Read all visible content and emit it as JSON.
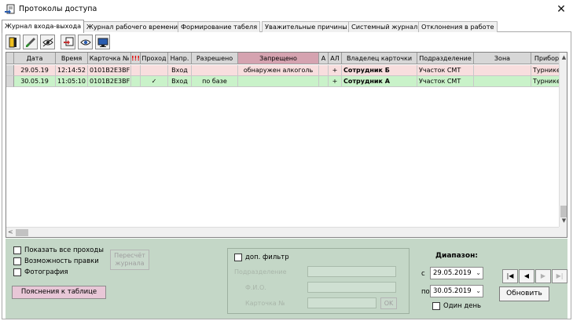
{
  "window": {
    "title": "Протоколы доступа",
    "close_glyph": "✕",
    "app_icon": "document-arrow-icon"
  },
  "tabs": [
    {
      "label": "Журнал входа-выхода",
      "active": true
    },
    {
      "label": "Журнал рабочего времени",
      "active": false
    },
    {
      "label": "Формирование табеля",
      "active": false
    },
    {
      "label": "Уважительные причины",
      "active": false
    },
    {
      "label": "Системный журнал",
      "active": false
    },
    {
      "label": "Отклонения в работе",
      "active": false
    }
  ],
  "toolbar": {
    "buttons": [
      "door-exit-icon",
      "brush-icon",
      "eye-hidden-icon",
      "export-icon",
      "eye-icon",
      "monitor-icon"
    ]
  },
  "grid": {
    "headers": [
      "Дата",
      "Время",
      "Карточка №",
      "!!!",
      "Проход",
      "Напр.",
      "Разрешено",
      "Запрещено",
      "А",
      "АЛ",
      "Владелец карточки",
      "Подразделение",
      "Зона",
      "Прибор"
    ],
    "rows": [
      {
        "status": "denied",
        "cells": [
          "29.05.19",
          "12:14:52",
          "0101B2E3BF",
          "",
          "",
          "Вход",
          "",
          "обнаружен алкоголь",
          "",
          "+",
          "Сотрудник Б",
          "Участок СМТ",
          "",
          "Турникет"
        ]
      },
      {
        "status": "allowed",
        "cells": [
          "30.05.19",
          "11:05:10",
          "0101B2E3BF",
          "",
          "✓",
          "Вход",
          "по базе",
          "",
          "",
          "+",
          "Сотрудник А",
          "Участок СМТ",
          "",
          "Турникет"
        ]
      }
    ],
    "colors": {
      "denied_row": "#f8dede",
      "allowed_row": "#c9f2c9",
      "forbidden_header": "#d5a3b0"
    }
  },
  "options": {
    "show_all": {
      "label": "Показать все проходы",
      "checked": false
    },
    "allow_edit": {
      "label": "Возможность правки",
      "checked": false
    },
    "photo": {
      "label": "Фотография",
      "checked": false
    },
    "recalc_line1": "Пересчёт",
    "recalc_line2": "журнала",
    "legend_button": "Пояснения к таблице"
  },
  "filter": {
    "extra_filter": {
      "label": "доп. фильтр",
      "checked": false
    },
    "department_label": "Подразделение",
    "fio_label": "Ф.И.О.",
    "card_label": "Карточка №",
    "ok_label": "OK"
  },
  "range": {
    "title": "Диапазон:",
    "from_label": "с",
    "from_value": "29.05.2019",
    "to_label": "по",
    "to_value": "30.05.2019",
    "one_day": {
      "label": "Один день",
      "checked": false
    }
  },
  "nav": {
    "first": "|◀",
    "prev": "◀",
    "next": "▶",
    "last": "▶|",
    "refresh_label": "Обновить"
  }
}
